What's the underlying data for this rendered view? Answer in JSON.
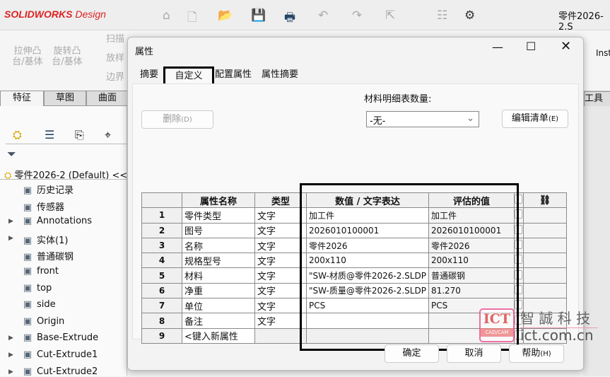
{
  "app": {
    "logo": "SOLIDWORKS",
    "logo_suffix": "Design",
    "doc_title": "零件2026-2.S",
    "inst": "Inst"
  },
  "ribbon": {
    "extrude": "拉伸凸台/基体",
    "revolve": "旋转凸台/基体",
    "sweep": "扫描",
    "loft": "放样",
    "boundary": "边界",
    "tools_tab": "工具"
  },
  "cm_tabs": [
    "特征",
    "草图",
    "曲面"
  ],
  "tree": {
    "root": "零件2026-2 (Default) <<",
    "items": [
      {
        "label": "历史记录",
        "icon": "history-folder-icon",
        "exp": false
      },
      {
        "label": "传感器",
        "icon": "sensor-folder-icon",
        "exp": false
      },
      {
        "label": "Annotations",
        "icon": "annotations-folder-icon",
        "exp": true
      },
      {
        "label": "实体(1)",
        "icon": "solid-bodies-folder-icon",
        "exp": true
      },
      {
        "label": "普通碳钢",
        "icon": "material-icon",
        "exp": false
      },
      {
        "label": "front",
        "icon": "plane-icon",
        "exp": false
      },
      {
        "label": "top",
        "icon": "plane-icon",
        "exp": false
      },
      {
        "label": "side",
        "icon": "plane-icon",
        "exp": false
      },
      {
        "label": "Origin",
        "icon": "origin-icon",
        "exp": false
      },
      {
        "label": "Base-Extrude",
        "icon": "extrude-icon",
        "exp": true
      },
      {
        "label": "Cut-Extrude1",
        "icon": "cut-extrude-icon",
        "exp": true
      },
      {
        "label": "Cut-Extrude2",
        "icon": "cut-extrude-icon",
        "exp": true
      }
    ]
  },
  "dialog": {
    "title": "属性",
    "tabs": [
      "摘要",
      "自定义",
      "配置属性",
      "属性摘要"
    ],
    "active_tab": "自定义",
    "delete": "删除",
    "delete_key": "(D)",
    "bom_label": "材料明细表数量:",
    "bom_value": "-无-",
    "edit_list": "编辑清单",
    "edit_list_key": "(E)",
    "ok": "确定",
    "cancel": "取消",
    "help": "帮助",
    "help_key": "(H)",
    "headers": [
      "属性名称",
      "类型",
      "数值 / 文字表达",
      "评估的值"
    ],
    "rows": [
      [
        "1",
        "零件类型",
        "文字",
        "加工件",
        "加工件"
      ],
      [
        "2",
        "图号",
        "文字",
        "2026010100001",
        "2026010100001"
      ],
      [
        "3",
        "名称",
        "文字",
        "零件2026",
        "零件2026"
      ],
      [
        "4",
        "规格型号",
        "文字",
        "200x110",
        "200x110"
      ],
      [
        "5",
        "材料",
        "文字",
        "\"SW-材质@零件2026-2.SLDP",
        "普通碳钢"
      ],
      [
        "6",
        "净重",
        "文字",
        "\"SW-质量@零件2026-2.SLDP",
        "81.270"
      ],
      [
        "7",
        "单位",
        "文字",
        "PCS",
        "PCS"
      ],
      [
        "8",
        "备注",
        "文字",
        "",
        ""
      ],
      [
        "9",
        "<键入新属性",
        "",
        "",
        ""
      ]
    ]
  },
  "watermark": {
    "logo": "ICT",
    "sub": "CAD/CAM",
    "name": "智 誠 科 技",
    "url": "ict.com.cn"
  }
}
